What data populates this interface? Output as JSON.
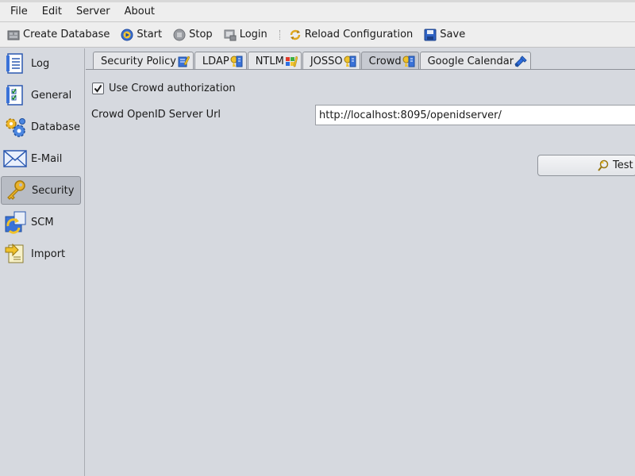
{
  "menu": {
    "file": "File",
    "edit": "Edit",
    "server": "Server",
    "about": "About"
  },
  "toolbar": {
    "create_database": "Create Database",
    "start": "Start",
    "stop": "Stop",
    "login": "Login",
    "reload_configuration": "Reload Configuration",
    "save": "Save"
  },
  "sidebar": {
    "items": [
      {
        "label": "Log",
        "icon": "document-list-icon"
      },
      {
        "label": "General",
        "icon": "checklist-icon"
      },
      {
        "label": "Database",
        "icon": "gears-icon"
      },
      {
        "label": "E-Mail",
        "icon": "envelope-icon"
      },
      {
        "label": "Security",
        "icon": "key-icon",
        "active": true
      },
      {
        "label": "SCM",
        "icon": "scm-icon"
      },
      {
        "label": "Import",
        "icon": "import-icon"
      }
    ]
  },
  "tabs": [
    {
      "label": "Security Policy",
      "icon": "policy-icon"
    },
    {
      "label": "LDAP",
      "icon": "ldap-icon"
    },
    {
      "label": "NTLM",
      "icon": "ntlm-icon"
    },
    {
      "label": "JOSSO",
      "icon": "josso-icon"
    },
    {
      "label": "Crowd",
      "icon": "crowd-icon",
      "active": true
    },
    {
      "label": "Google Calendar",
      "icon": "google-calendar-icon"
    }
  ],
  "crowd": {
    "use_crowd_label": "Use Crowd authorization",
    "use_crowd_checked": true,
    "server_url_label": "Crowd OpenID Server Url",
    "server_url_value": "http://localhost:8095/openidserver/",
    "test_button": "Test"
  }
}
